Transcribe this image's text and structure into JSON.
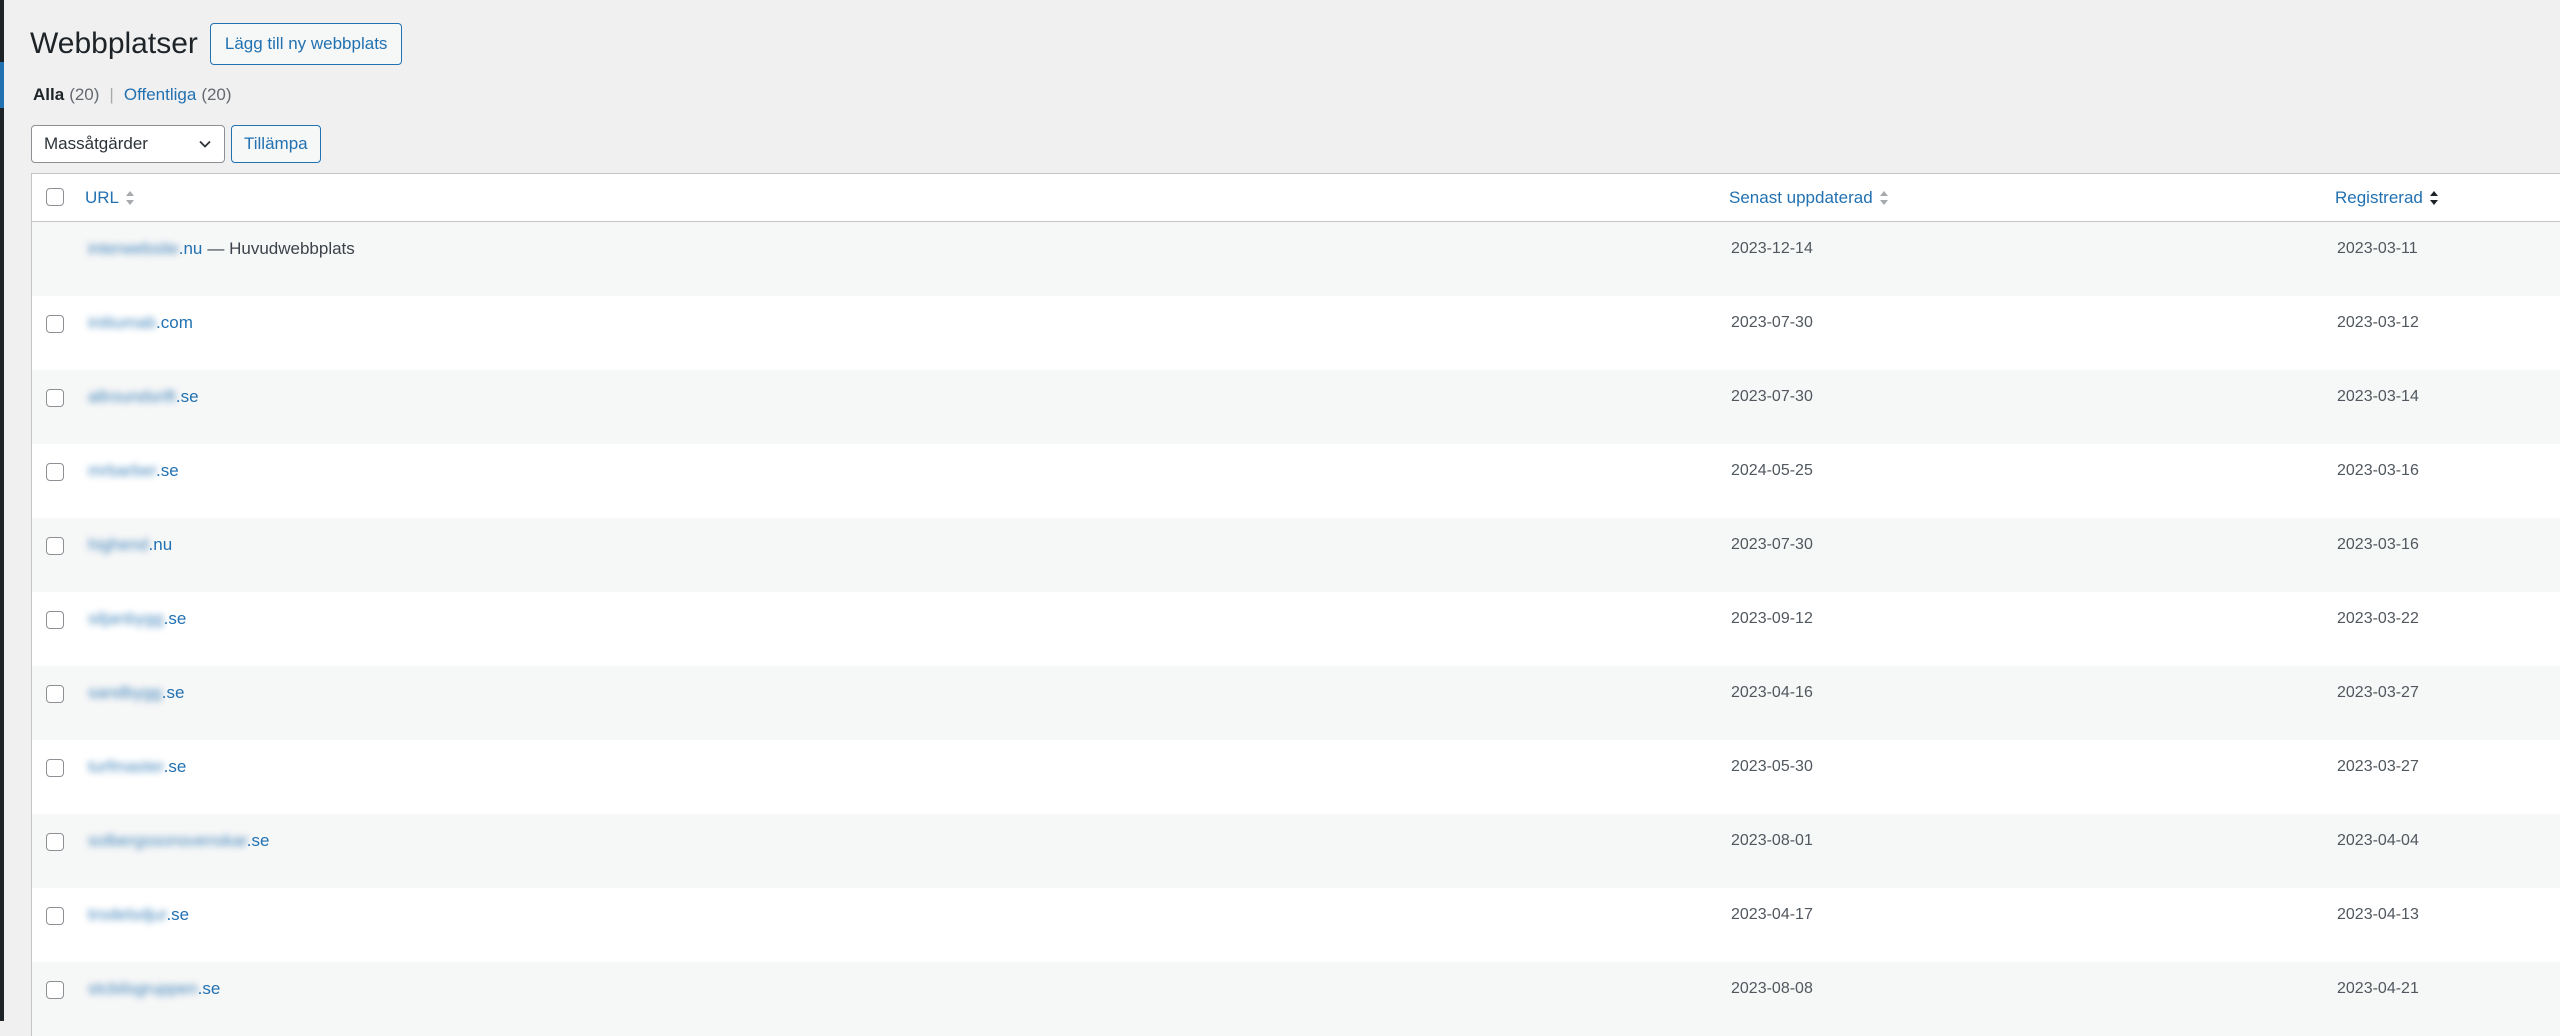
{
  "header": {
    "title": "Webbplatser",
    "add_button": "Lägg till ny webbplats"
  },
  "filters": {
    "all_label": "Alla",
    "all_count": "(20)",
    "separator": "|",
    "public_label": "Offentliga",
    "public_count": "(20)"
  },
  "tablenav": {
    "bulk_selected": "Massåtgärder",
    "apply_label": "Tillämpa"
  },
  "table": {
    "columns": {
      "url": "URL",
      "updated": "Senast uppdaterad",
      "registered": "Registrerad"
    },
    "rows": [
      {
        "name": "interwebsite",
        "tld": ".nu",
        "suffix": "— Huvudwebbplats",
        "updated": "2023-12-14",
        "registered": "2023-03-11"
      },
      {
        "name": "initiumab",
        "tld": ".com",
        "suffix": "",
        "updated": "2023-07-30",
        "registered": "2023-03-12"
      },
      {
        "name": "allroundsrift",
        "tld": ".se",
        "suffix": "",
        "updated": "2023-07-30",
        "registered": "2023-03-14"
      },
      {
        "name": "mrbarber",
        "tld": ".se",
        "suffix": "",
        "updated": "2024-05-25",
        "registered": "2023-03-16"
      },
      {
        "name": "highend",
        "tld": ".nu",
        "suffix": "",
        "updated": "2023-07-30",
        "registered": "2023-03-16"
      },
      {
        "name": "siljanbygg",
        "tld": ".se",
        "suffix": "",
        "updated": "2023-09-12",
        "registered": "2023-03-22"
      },
      {
        "name": "sandbygg",
        "tld": ".se",
        "suffix": "",
        "updated": "2023-04-16",
        "registered": "2023-03-27"
      },
      {
        "name": "turfmaster",
        "tld": ".se",
        "suffix": "",
        "updated": "2023-05-30",
        "registered": "2023-03-27"
      },
      {
        "name": "solbergssonsvenskar",
        "tld": ".se",
        "suffix": "",
        "updated": "2023-08-01",
        "registered": "2023-04-04"
      },
      {
        "name": "trodelsdjur",
        "tld": ".se",
        "suffix": "",
        "updated": "2023-04-17",
        "registered": "2023-04-13"
      },
      {
        "name": "stcbilsgruppen",
        "tld": ".se",
        "suffix": "",
        "updated": "2023-08-08",
        "registered": "2023-04-21"
      }
    ]
  }
}
